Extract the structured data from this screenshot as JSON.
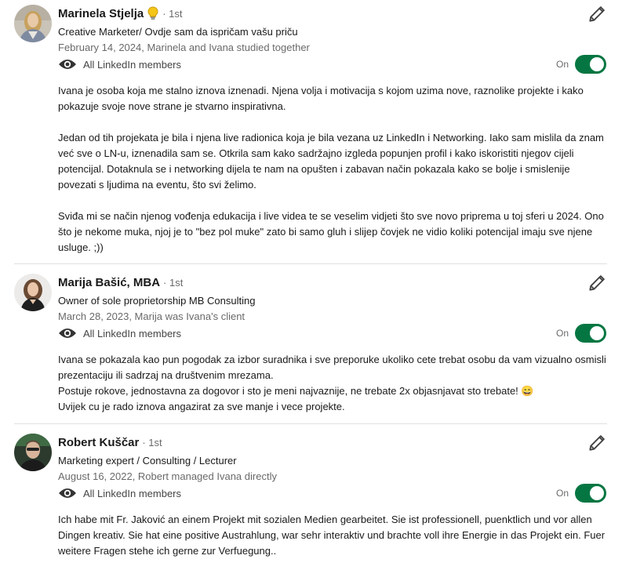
{
  "recommendations": [
    {
      "name": "Marinela Stjelja",
      "badge_icon": "lightbulb-icon",
      "degree": "· 1st",
      "headline": "Creative Marketer/ Ovdje sam da ispričam vašu priču",
      "meta": "February 14, 2024, Marinela and Ivana studied together",
      "visibility": "All LinkedIn members",
      "toggle_label": "On",
      "paragraphs": [
        "Ivana je osoba koja me stalno iznova iznenadi. Njena volja i motivacija s kojom uzima nove, raznolike projekte i kako pokazuje svoje nove strane je stvarno inspirativna.",
        "Jedan od tih projekata je bila i njena live radionica koja je bila vezana uz LinkedIn i Networking. Iako sam mislila da znam već sve o LN-u, iznenadila sam se. Otkrila sam kako sadržajno izgleda popunjen profil i kako iskoristiti njegov cijeli potencijal. Dotaknula se i networking dijela te nam na opušten i zabavan način pokazala kako se bolje i smislenije povezati s ljudima na eventu, što svi želimo.",
        "Sviđa mi se način njenog vođenja edukacija i live videa te se veselim vidjeti što sve novo priprema u toj sferi u 2024. Ono što je nekome muka, njoj je to \"bez pol muke\" zato bi samo gluh i slijep čovjek ne vidio koliki potencijal imaju sve njene usluge. ;))"
      ]
    },
    {
      "name": "Marija Bašić, MBA",
      "degree": "· 1st",
      "headline": "Owner of sole proprietorship MB Consulting",
      "meta": "March 28, 2023, Marija was Ivana's client",
      "visibility": "All LinkedIn members",
      "toggle_label": "On",
      "lines": [
        "Ivana se pokazala kao pun pogodak za izbor suradnika i sve preporuke ukoliko cete trebat osobu da vam vizualno osmisli prezentaciju ili sadrzaj na društvenim mrezama.",
        "Postuje rokove, jednostavna za dogovor i sto je meni najvaznije, ne trebate 2x objasnjavat sto trebate! 😄",
        "Uvijek cu je rado iznova angazirat za sve manje i vece projekte."
      ]
    },
    {
      "name": "Robert Kuščar",
      "degree": "· 1st",
      "headline": "Marketing expert / Consulting / Lecturer",
      "meta": "August 16, 2022, Robert managed Ivana directly",
      "visibility": "All LinkedIn members",
      "toggle_label": "On",
      "paragraphs": [
        "Ich habe mit Fr. Jaković an einem Projekt mit sozialen Medien gearbeitet. Sie ist professionell, puenktlich und vor allen Dingen kreativ. Sie hat eine positive Austrahlung, war sehr interaktiv und brachte voll ihre Energie in das Projekt ein. Fuer weitere Fragen stehe ich gerne zur Verfuegung.."
      ]
    }
  ],
  "colors": {
    "toggle_on": "#057642",
    "muted_text": "#666666",
    "divider": "#e0e0e0"
  }
}
